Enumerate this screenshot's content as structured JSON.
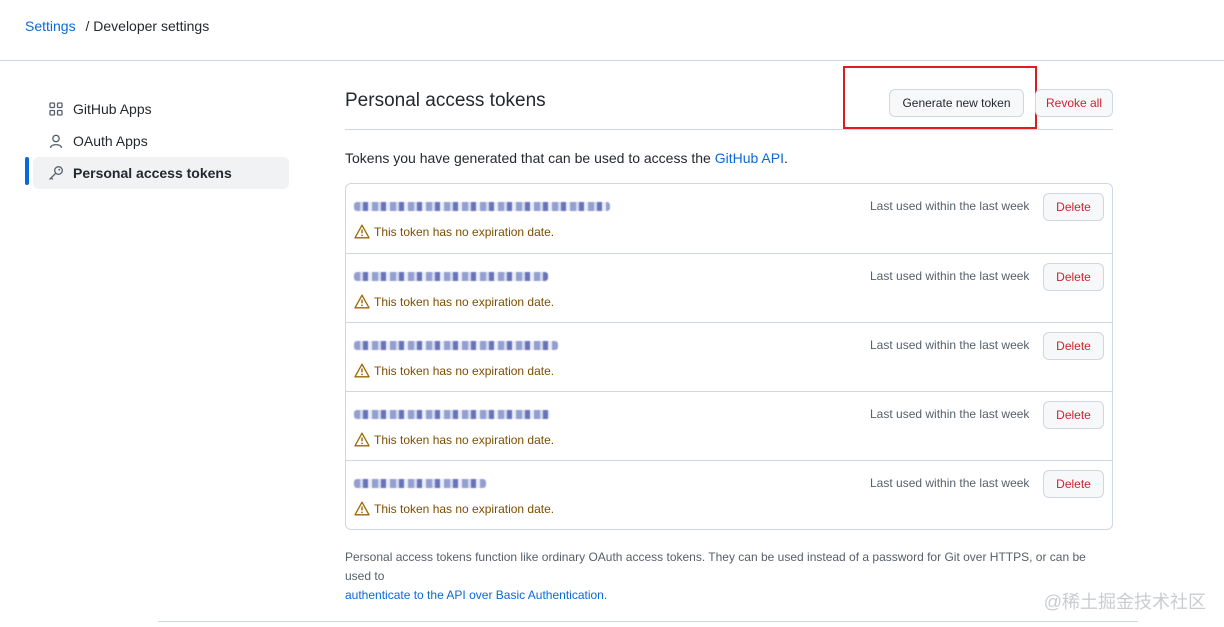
{
  "breadcrumb": {
    "root": "Settings",
    "separator": "/",
    "current": "Developer settings"
  },
  "sidebar": {
    "items": [
      {
        "label": "GitHub Apps",
        "icon": "apps-grid-icon"
      },
      {
        "label": "OAuth Apps",
        "icon": "person-icon"
      },
      {
        "label": "Personal access tokens",
        "icon": "key-icon",
        "active": true
      }
    ]
  },
  "main": {
    "title": "Personal access tokens",
    "generate_label": "Generate new token",
    "revoke_label": "Revoke all",
    "description_prefix": "Tokens you have generated that can be used to access the ",
    "description_link": "GitHub API",
    "description_suffix": ".",
    "tokens": [
      {
        "last_used": "Last used within the last week",
        "warning": "This token has no expiration date.",
        "delete_label": "Delete"
      },
      {
        "last_used": "Last used within the last week",
        "warning": "This token has no expiration date.",
        "delete_label": "Delete"
      },
      {
        "last_used": "Last used within the last week",
        "warning": "This token has no expiration date.",
        "delete_label": "Delete"
      },
      {
        "last_used": "Last used within the last week",
        "warning": "This token has no expiration date.",
        "delete_label": "Delete"
      },
      {
        "last_used": "Last used within the last week",
        "warning": "This token has no expiration date.",
        "delete_label": "Delete"
      }
    ],
    "footnote_text": "Personal access tokens function like ordinary OAuth access tokens. They can be used instead of a password for Git over HTTPS, or can be used to",
    "footnote_link": "authenticate to the API over Basic Authentication",
    "footnote_suffix": "."
  },
  "watermark": "@稀土掘金技术社区",
  "colors": {
    "accent": "#0969da",
    "danger": "#cf222e",
    "warning": "#9a6700",
    "highlight_box": "#e01b24"
  }
}
